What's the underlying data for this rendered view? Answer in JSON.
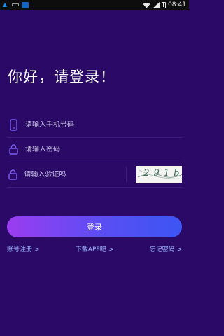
{
  "status_bar": {
    "time": "08:41",
    "icons": [
      "bird-icon",
      "usb-icon",
      "app-icon",
      "wifi-icon",
      "signal-icon",
      "battery-icon"
    ]
  },
  "greeting": "你好，请登录！",
  "form": {
    "phone": {
      "placeholder": "请输入手机号码",
      "value": "",
      "icon": "phone-icon"
    },
    "password": {
      "placeholder": "请输入密码",
      "value": "",
      "icon": "lock-icon"
    },
    "captcha": {
      "placeholder": "请输入验证吗",
      "value": "",
      "icon": "lock-icon",
      "image_text": "291b"
    }
  },
  "login_button": "登录",
  "links": {
    "register": "账号注册 >",
    "download": "下载APP吧 >",
    "forgot": "忘记密码 >"
  },
  "colors": {
    "background": "#2a0a66",
    "icon": "#7b5ff0",
    "link": "#9fb6ff",
    "button_start": "#9b3cf0",
    "button_end": "#3c55f3"
  }
}
